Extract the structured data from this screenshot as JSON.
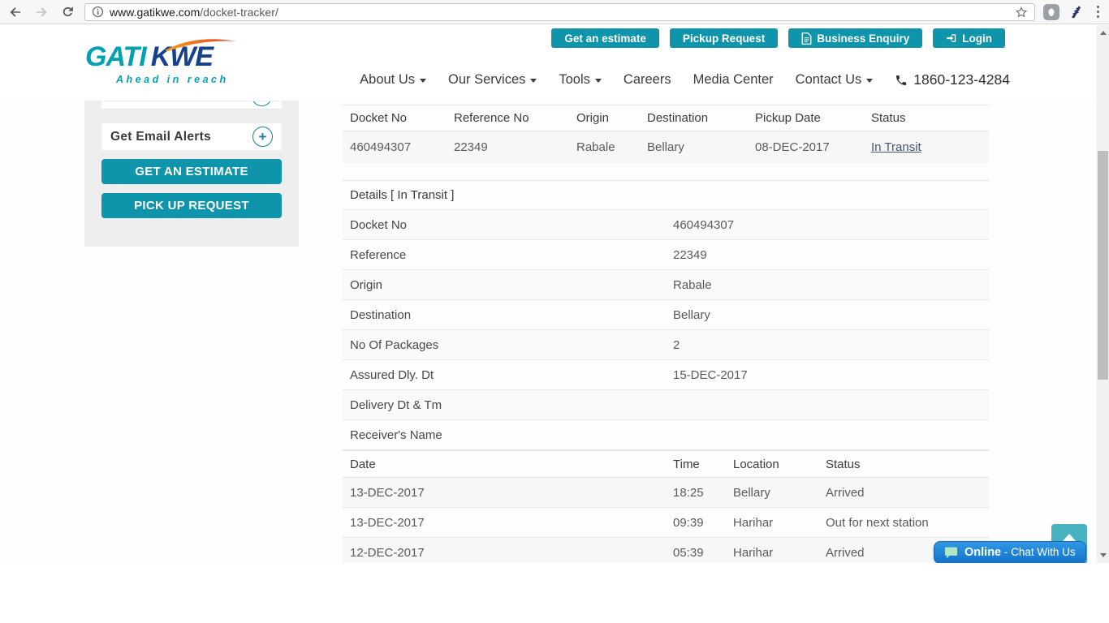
{
  "browser": {
    "url_domain": "www.gatikwe.com",
    "url_path": "/docket-tracker/"
  },
  "header": {
    "actions": {
      "estimate": "Get an estimate",
      "pickup": "Pickup Request",
      "enquiry": "Business Enquiry",
      "login": "Login"
    },
    "logo": {
      "gati": "GATI",
      "kwe": "KWE",
      "tagline": "Ahead in reach"
    },
    "nav": [
      {
        "label": "About Us"
      },
      {
        "label": "Our Services"
      },
      {
        "label": "Tools"
      },
      {
        "label": "Careers"
      },
      {
        "label": "Media Center"
      },
      {
        "label": "Contact Us"
      }
    ],
    "phone": "1860-123-4284"
  },
  "sidebar": {
    "email_alerts": "Get Email Alerts",
    "estimate_btn": "GET AN ESTIMATE",
    "pickup_btn": "PICK UP REQUEST"
  },
  "summary": {
    "headers": [
      "Docket No",
      "Reference No",
      "Origin",
      "Destination",
      "Pickup Date",
      "Status"
    ],
    "row": {
      "docket": "460494307",
      "reference": "22349",
      "origin": "Rabale",
      "destination": "Bellary",
      "pickup_date": "08-DEC-2017",
      "status": "In Transit"
    }
  },
  "details": {
    "title": "Details [ In Transit ]",
    "rows": [
      {
        "label": "Docket No",
        "value": "460494307"
      },
      {
        "label": "Reference",
        "value": "22349"
      },
      {
        "label": "Origin",
        "value": "Rabale"
      },
      {
        "label": "Destination",
        "value": "Bellary"
      },
      {
        "label": "No Of Packages",
        "value": "2"
      },
      {
        "label": "Assured Dly. Dt",
        "value": "15-DEC-2017"
      },
      {
        "label": "Delivery Dt & Tm",
        "value": ""
      },
      {
        "label": "Receiver's Name",
        "value": ""
      }
    ]
  },
  "history": {
    "headers": [
      "Date",
      "Time",
      "Location",
      "Status"
    ],
    "rows": [
      [
        "13-DEC-2017",
        "18:25",
        "Bellary",
        "Arrived"
      ],
      [
        "13-DEC-2017",
        "09:39",
        "Harihar",
        "Out for next station"
      ],
      [
        "12-DEC-2017",
        "05:39",
        "Harihar",
        "Arrived"
      ]
    ]
  },
  "chat": {
    "status": "Online",
    "label": "- Chat With Us"
  },
  "colors": {
    "teal": "#0e95ab",
    "logo_blue": "#17418e",
    "chat_blue": "#1e7fd2",
    "link": "#44546a"
  }
}
